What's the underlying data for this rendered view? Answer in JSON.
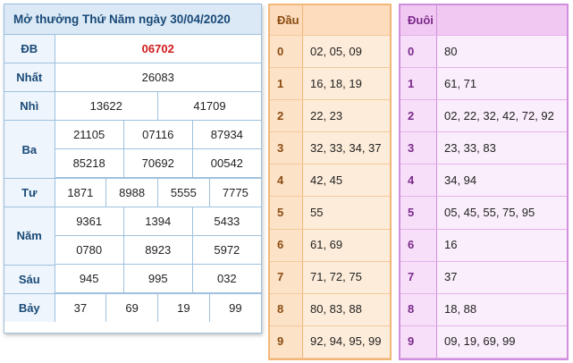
{
  "results": {
    "title": "Mở thưởng Thứ Năm ngày 30/04/2020",
    "db_label": "ĐB",
    "db": "06702",
    "nhat_label": "Nhất",
    "nhat": "26083",
    "nhi_label": "Nhì",
    "nhi": [
      "13622",
      "41709"
    ],
    "ba_label": "Ba",
    "ba": [
      "21105",
      "07116",
      "87934",
      "85218",
      "70692",
      "00542"
    ],
    "tu_label": "Tư",
    "tu": [
      "1871",
      "8988",
      "5555",
      "7775"
    ],
    "nam_label": "Năm",
    "nam": [
      "9361",
      "1394",
      "5433",
      "0780",
      "8923",
      "5972"
    ],
    "sau_label": "Sáu",
    "sau": [
      "945",
      "995",
      "032"
    ],
    "bay_label": "Bảy",
    "bay": [
      "37",
      "69",
      "19",
      "99"
    ]
  },
  "dau": {
    "header": "Đầu",
    "rows": [
      {
        "k": "0",
        "v": "02, 05, 09"
      },
      {
        "k": "1",
        "v": "16, 18, 19"
      },
      {
        "k": "2",
        "v": "22, 23"
      },
      {
        "k": "3",
        "v": "32, 33, 34, 37"
      },
      {
        "k": "4",
        "v": "42, 45"
      },
      {
        "k": "5",
        "v": "55"
      },
      {
        "k": "6",
        "v": "61, 69"
      },
      {
        "k": "7",
        "v": "71, 72, 75"
      },
      {
        "k": "8",
        "v": "80, 83, 88"
      },
      {
        "k": "9",
        "v": "92, 94, 95, 99"
      }
    ]
  },
  "duoi": {
    "header": "Đuôi",
    "rows": [
      {
        "k": "0",
        "v": "80"
      },
      {
        "k": "1",
        "v": "61, 71"
      },
      {
        "k": "2",
        "v": "02, 22, 32, 42, 72, 92"
      },
      {
        "k": "3",
        "v": "23, 33, 83"
      },
      {
        "k": "4",
        "v": "34, 94"
      },
      {
        "k": "5",
        "v": "05, 45, 55, 75, 95"
      },
      {
        "k": "6",
        "v": "16"
      },
      {
        "k": "7",
        "v": "37"
      },
      {
        "k": "8",
        "v": "18, 88"
      },
      {
        "k": "9",
        "v": "09, 19, 69, 99"
      }
    ]
  }
}
